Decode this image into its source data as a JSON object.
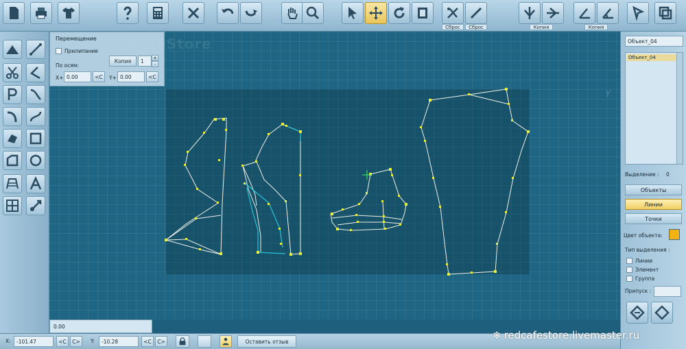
{
  "toolbar": {
    "reset_label_1": "Сброс",
    "reset_label_2": "Сброс",
    "copy_label_1": "Копия",
    "copy_label_2": "Копия"
  },
  "move_panel": {
    "title": "Перемещение",
    "snap_label": "Прилипание",
    "copy_button": "Копия",
    "copy_count": "1",
    "axes_label": "По осям:",
    "x_label": "X+",
    "x_value": "0.00",
    "y_label": "Y+",
    "y_value": "0.00",
    "c_button": "<C"
  },
  "canvas": {
    "ghost_brand": "RedCafeStore",
    "axis_y": "Y"
  },
  "right_panel": {
    "object_name_field": "Объект_04",
    "object_list": [
      "Объект_04"
    ],
    "selection_label": "Выделение :",
    "selection_count": "0",
    "objects_button": "Объекты",
    "lines_button": "Линии",
    "points_button": "Точки",
    "object_color_label": "Цвет объекта:",
    "object_color": "#f2b312",
    "selection_type_label": "Тип выделения :",
    "selection_types": [
      "Линии",
      "Элемент",
      "Группа"
    ],
    "tolerance_label": "Припуск :"
  },
  "status": {
    "value": "0.00",
    "x_label": "X:",
    "x_value": "-101.47",
    "y_label": "Y:",
    "y_value": "-10.28",
    "c_button": "<C",
    "c_next_button": "C>",
    "feedback_button": "Оставить отзыв"
  },
  "watermark": "redcafestore.livemaster.ru",
  "colors": {
    "canvas": "#1e6683",
    "pattern_line": "#f2f2e8",
    "pattern_point": "#e7f03c",
    "selected_line": "#26c4d8",
    "active_tool": "#e8c55a"
  },
  "icons": {
    "top": [
      "new-file-icon",
      "print-icon",
      "shirt-icon",
      "help-icon",
      "calculator-icon",
      "close-x-icon",
      "undo-icon",
      "redo-icon",
      "hand-icon",
      "zoom-icon",
      "pointer-icon",
      "move-icon",
      "rotate-icon",
      "mirror-icon",
      "reset-cut-icon",
      "reset-line-icon",
      "copy-mirror-vertical-icon",
      "copy-mirror-horizontal-icon",
      "angle-icon",
      "arc-angle-icon",
      "shape-select-icon",
      "layers-icon"
    ],
    "left": [
      "triangle-icon",
      "scissors-icon",
      "letter-p-icon",
      "arc-icon",
      "shape-icon",
      "polygon-icon",
      "fan-icon",
      "grid-icon",
      "line-icon",
      "corner-icon",
      "curve-icon",
      "s-curve-icon",
      "rectangle-icon",
      "circle-icon",
      "letter-a-icon",
      "measure-icon"
    ]
  }
}
